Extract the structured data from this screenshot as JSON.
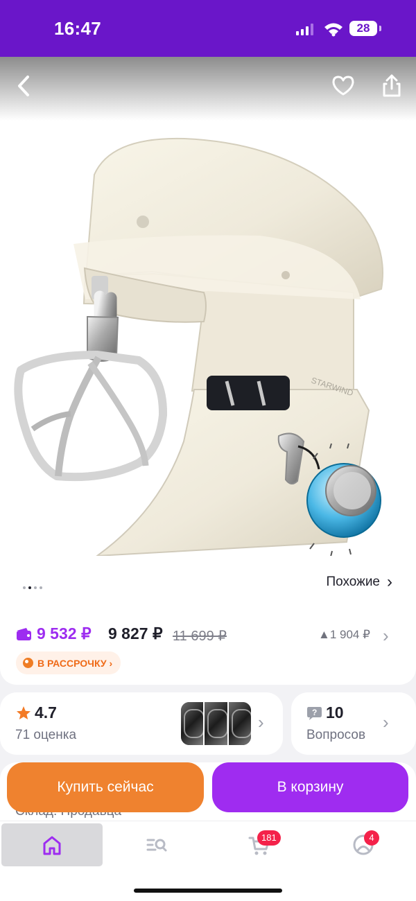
{
  "status_bar": {
    "time": "16:47",
    "battery": "28"
  },
  "gallery": {
    "brand_text": "STARWIND",
    "dots": [
      false,
      true,
      false,
      false
    ]
  },
  "icons": {
    "back": "chevron-left-icon",
    "favorite": "heart-icon",
    "share": "share-icon",
    "wallet": "wallet-icon",
    "star": "star-icon",
    "question": "question-icon",
    "installment": "pie-icon"
  },
  "similar": {
    "label": "Похожие",
    "chevron": "›"
  },
  "price": {
    "wallet_price": "9 532 ₽",
    "current_price": "9 827 ₽",
    "old_price": "11 699 ₽",
    "price_delta": "▲1 904 ₽",
    "chevron": "›",
    "installment": "В РАССРОЧКУ ›"
  },
  "rating": {
    "value": "4.7",
    "count": "71 оценка",
    "chevron": "›"
  },
  "questions": {
    "count": "10",
    "label": "Вопросов",
    "chevron": "›"
  },
  "warehouse": {
    "text": "Склад: Продавца"
  },
  "actions": {
    "buy_now": "Купить сейчас",
    "add_to_cart": "В корзину"
  },
  "tabs": {
    "cart_badge": "181",
    "profile_badge": "4"
  },
  "colors": {
    "brand_purple": "#6a16c9",
    "accent_purple": "#9f2cf0",
    "orange": "#ef822f",
    "badge_red": "#f4224a"
  }
}
